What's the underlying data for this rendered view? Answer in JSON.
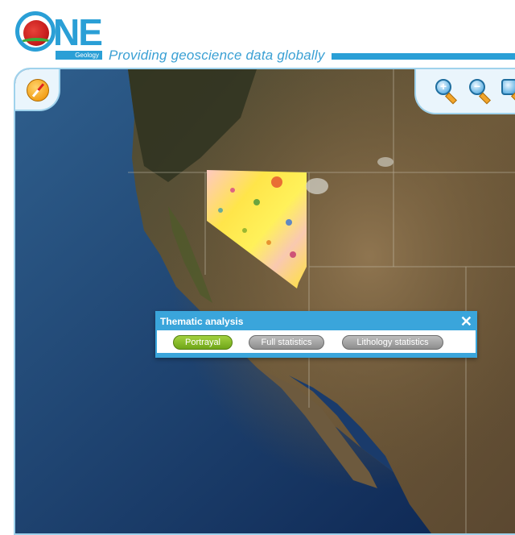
{
  "header": {
    "logo_text": "NE",
    "logo_subtext": "Geology",
    "tagline": "Providing geoscience data globally"
  },
  "map": {
    "layer": "satellite-imagery",
    "overlay": "geology-portrayal-nevada"
  },
  "controls": {
    "compass_icon": "compass-icon",
    "zoom_in_symbol": "+",
    "zoom_out_symbol": "−",
    "zoom_extent_icon": "zoom-extent-icon"
  },
  "dialog": {
    "title": "Thematic analysis",
    "close_symbol": "✕",
    "buttons": [
      {
        "label": "Portrayal",
        "active": true
      },
      {
        "label": "Full statistics",
        "active": false
      },
      {
        "label": "Lithology statistics",
        "active": false
      }
    ]
  },
  "colors": {
    "brand_blue": "#2a9fd6",
    "active_green": "#8bc02c",
    "inactive_gray": "#a0a0a0"
  }
}
